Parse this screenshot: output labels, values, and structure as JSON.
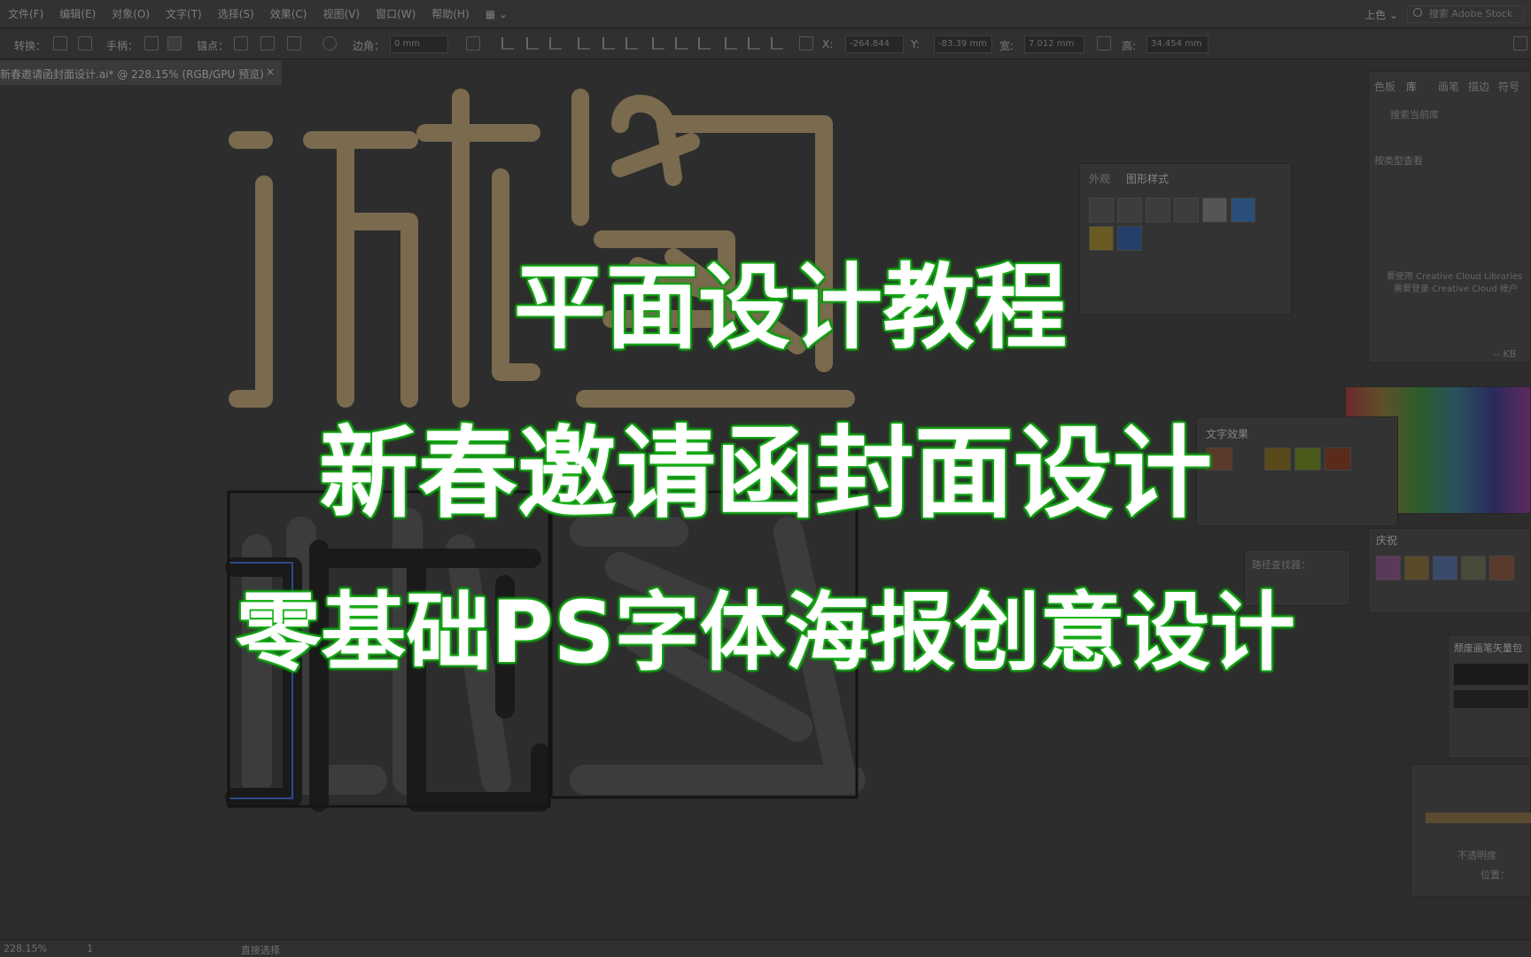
{
  "menu": [
    "文件(F)",
    "编辑(E)",
    "对象(O)",
    "文字(T)",
    "选择(S)",
    "效果(C)",
    "视图(V)",
    "窗口(W)",
    "帮助(H)"
  ],
  "workspace": "上色",
  "stock_search": "搜索 Adobe Stock",
  "control": {
    "convert": "转换：",
    "handle": "手柄：",
    "anchor": "锚点：",
    "corner": "边角：",
    "corner_val": "0 mm",
    "x": "X:",
    "x_val": "-264.844",
    "y": "Y:",
    "y_val": "-83.39 mm",
    "w": "宽:",
    "w_val": "7.012 mm",
    "h": "高:",
    "h_val": "34.454 mm"
  },
  "doc_tab": "新春邀请函封面设计.ai* @ 228.15% (RGB/GPU 预览)",
  "doc_tab_close": "×",
  "status": {
    "zoom": "228.15%",
    "page": "1",
    "tool": "直接选择"
  },
  "panels": {
    "appearance_tabs": [
      "外观",
      "图形样式"
    ],
    "libraries_tabs": [
      "色板",
      "库",
      "画笔",
      "描边",
      "符号"
    ],
    "library_search": "搜索当前库",
    "library_view": "按类型查看",
    "cc_msg1": "要使用 Creative Cloud Libraries",
    "cc_msg2": "需要登录 Creative Cloud 帐户",
    "kb": "-- KB",
    "text_effects": "文字效果",
    "pathfinder": "路径查找器：",
    "festival": "庆祝",
    "brush_lib": "颓废画笔矢量包",
    "opacity": "不透明度",
    "position": "位置："
  },
  "overlay": {
    "line1": "平面设计教程",
    "line2": "新春邀请函封面设计",
    "line3": "零基础PS字体海报创意设计"
  },
  "colors": {
    "overlay_text": "#ffffff",
    "overlay_glow": "#1fb81f",
    "gold_stroke": "#7a6a4e"
  }
}
